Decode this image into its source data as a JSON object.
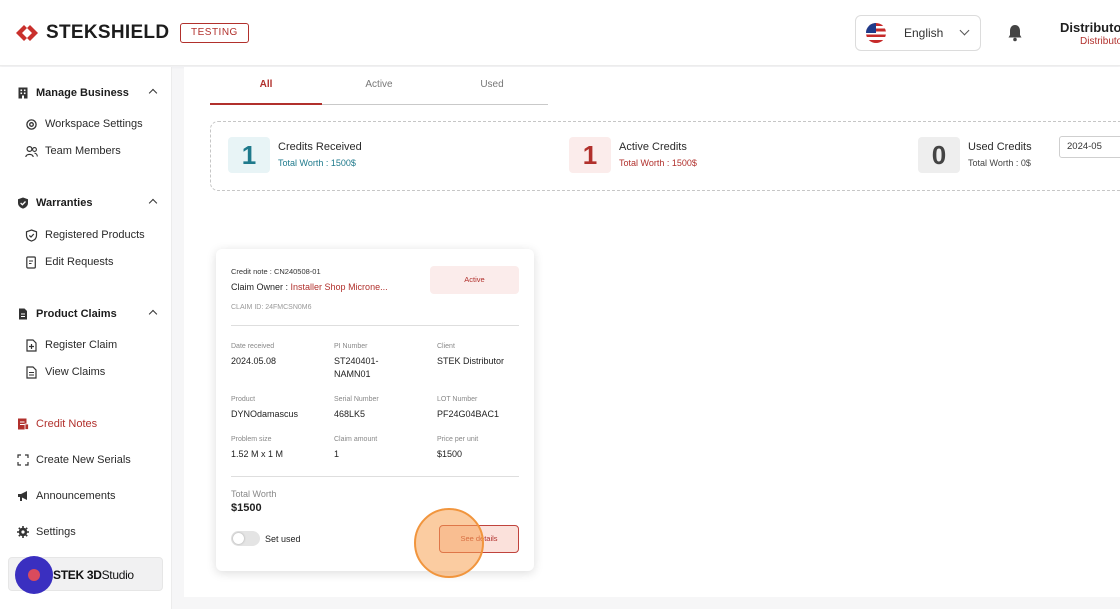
{
  "header": {
    "brand": "STEKSHIELD",
    "env_badge": "TESTING",
    "language": "English",
    "user_name": "Distributor",
    "user_role": "Distributor"
  },
  "sidebar": {
    "sections": [
      {
        "title": "Manage Business",
        "items": [
          "Workspace Settings",
          "Team Members"
        ]
      },
      {
        "title": "Warranties",
        "items": [
          "Registered Products",
          "Edit Requests"
        ]
      },
      {
        "title": "Product Claims",
        "items": [
          "Register Claim",
          "View Claims"
        ]
      }
    ],
    "top_items": [
      "Credit Notes",
      "Create New Serials",
      "Announcements",
      "Settings"
    ],
    "active_item": "Credit Notes",
    "studio_brand_bold": "STEK 3D",
    "studio_brand_light": "Studio"
  },
  "tabs": [
    "All",
    "Active",
    "Used"
  ],
  "active_tab": "All",
  "stats": [
    {
      "value": "1",
      "title": "Credits Received",
      "sub": "Total Worth : 1500$",
      "color": "#1f7a8c",
      "bg": "#e8f4f6"
    },
    {
      "value": "1",
      "title": "Active Credits",
      "sub": "Total Worth : 1500$",
      "color": "#b1302c",
      "bg": "#fbeceb"
    },
    {
      "value": "0",
      "title": "Used Credits",
      "sub": "Total Worth : 0$",
      "color": "#444444",
      "bg": "#eeeeee"
    }
  ],
  "date_filter": "2024-05",
  "card": {
    "credit_note": "Credit note : CN240508-01",
    "owner_label": "Claim Owner :",
    "owner_value": "Installer Shop Microne...",
    "claim_id": "CLAIM ID: 24FMCSN0M6",
    "status": "Active",
    "fields": [
      {
        "label": "Date received",
        "value": "2024.05.08"
      },
      {
        "label": "PI Number",
        "value": "ST240401-NAMN01"
      },
      {
        "label": "Client",
        "value": "STEK Distributor"
      },
      {
        "label": "Product",
        "value": "DYNOdamascus"
      },
      {
        "label": "Serial Number",
        "value": "468LK5"
      },
      {
        "label": "LOT Number",
        "value": "PF24G04BAC1"
      },
      {
        "label": "Problem size",
        "value": "1.52 M x 1 M"
      },
      {
        "label": "Claim amount",
        "value": "1"
      },
      {
        "label": "Price per unit",
        "value": "$1500"
      }
    ],
    "total_label": "Total Worth",
    "total_value": "$1500",
    "set_used_label": "Set used",
    "see_details_label": "See details"
  }
}
